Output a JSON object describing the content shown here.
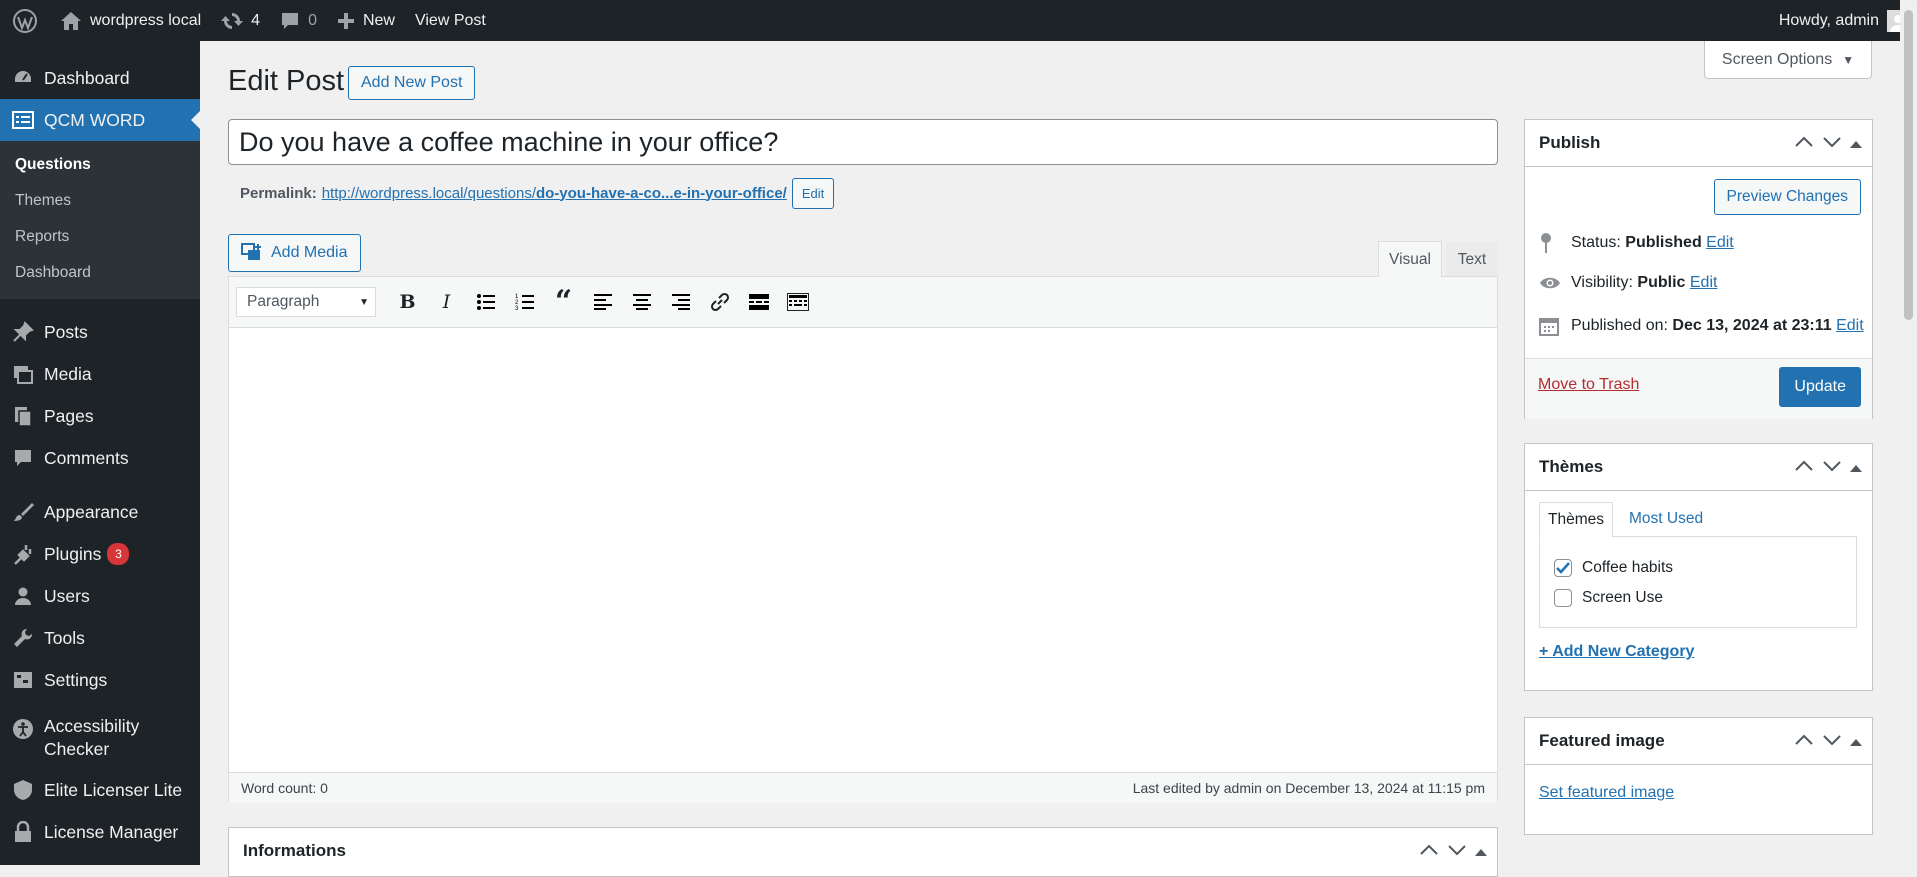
{
  "adminbar": {
    "site_name": "wordpress local",
    "updates_count": "4",
    "comments_count": "0",
    "new_label": "New",
    "view_post_label": "View Post",
    "howdy": "Howdy, admin"
  },
  "sidebar": {
    "dashboard": "Dashboard",
    "qcm_word": "QCM WORD",
    "submenu": [
      "Questions",
      "Themes",
      "Reports",
      "Dashboard"
    ],
    "posts": "Posts",
    "media": "Media",
    "pages": "Pages",
    "comments": "Comments",
    "appearance": "Appearance",
    "plugins": "Plugins",
    "plugins_badge": "3",
    "users": "Users",
    "tools": "Tools",
    "settings": "Settings",
    "accessibility_1": "Accessibility",
    "accessibility_2": "Checker",
    "elite": "Elite Licenser Lite",
    "license": "License Manager"
  },
  "header": {
    "title": "Edit Post",
    "add_new": "Add New Post",
    "screen_options": "Screen Options"
  },
  "post": {
    "title": "Do you have a coffee machine in your office?",
    "permalink_label": "Permalink:",
    "permalink_base": "http://wordpress.local/questions/",
    "permalink_slug": "do-you-have-a-co...e-in-your-office/",
    "permalink_edit": "Edit"
  },
  "editor": {
    "add_media": "Add Media",
    "tab_visual": "Visual",
    "tab_text": "Text",
    "format_select": "Paragraph",
    "word_count": "Word count: 0",
    "last_edited": "Last edited by admin on December 13, 2024 at 11:15 pm"
  },
  "informations": {
    "title": "Informations"
  },
  "publish": {
    "title": "Publish",
    "preview": "Preview Changes",
    "status_label": "Status:",
    "status_value": "Published",
    "visibility_label": "Visibility:",
    "visibility_value": "Public",
    "published_label": "Published on:",
    "published_value": "Dec 13, 2024 at 23:11",
    "edit": "Edit",
    "trash": "Move to Trash",
    "update": "Update"
  },
  "themes_box": {
    "title": "Thèmes",
    "tab_all": "Thèmes",
    "tab_used": "Most Used",
    "items": [
      {
        "label": "Coffee habits",
        "checked": true
      },
      {
        "label": "Screen Use",
        "checked": false
      }
    ],
    "add_new": "+ Add New Category"
  },
  "featured": {
    "title": "Featured image",
    "set": "Set featured image"
  },
  "colors": {
    "admin_bg": "#1d2327",
    "accent": "#2271b1",
    "badge": "#d63638"
  }
}
